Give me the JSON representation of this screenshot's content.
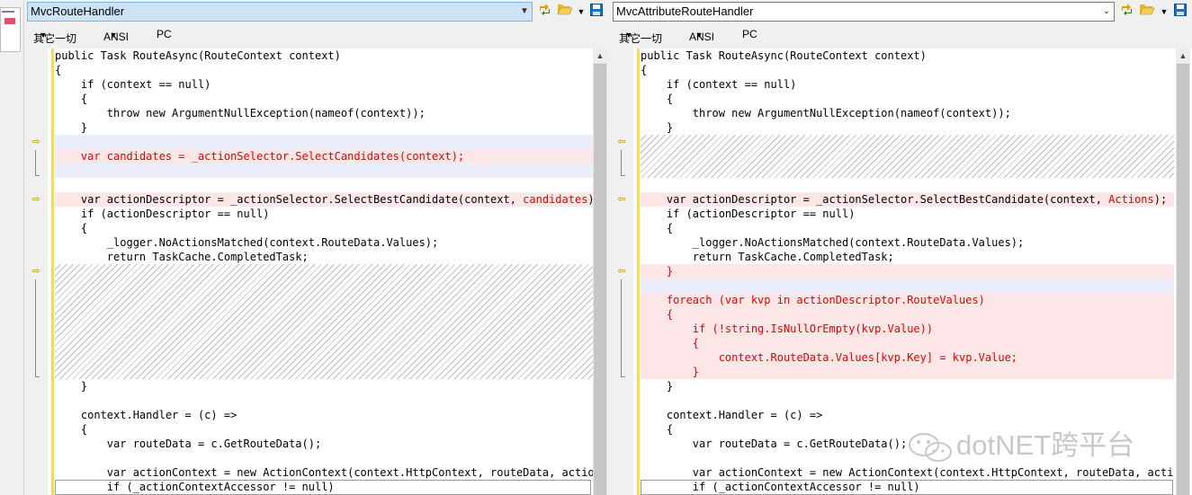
{
  "left": {
    "filename": "MvcRouteHandler",
    "encoding": {
      "charset": "其它一切",
      "format": "ANSI",
      "lineEnding": "PC"
    },
    "lines": [
      "public Task RouteAsync(RouteContext context)",
      "{",
      "    if (context == null)",
      "    {",
      "        throw new ArgumentNullException(nameof(context));",
      "    }",
      "",
      "    var candidates = _actionSelector.SelectCandidates(context);",
      "",
      "",
      "    var actionDescriptor = _actionSelector.SelectBestCandidate(context, ",
      "    if (actionDescriptor == null)",
      "    {",
      "        _logger.NoActionsMatched(context.RouteData.Values);",
      "        return TaskCache.CompletedTask;",
      "    }",
      "",
      "    context.Handler = (c) =>",
      "    {",
      "        var routeData = c.GetRouteData();",
      "",
      "        var actionContext = new ActionContext(context.HttpContext, routeData, actionD",
      "        if (_actionContextAccessor != null)"
    ],
    "diffToken": "candidates",
    "diffTokenSuffix": ");"
  },
  "right": {
    "filename": "MvcAttributeRouteHandler",
    "encoding": {
      "charset": "其它一切",
      "format": "ANSI",
      "lineEnding": "PC"
    },
    "lines": [
      "public Task RouteAsync(RouteContext context)",
      "{",
      "    if (context == null)",
      "    {",
      "        throw new ArgumentNullException(nameof(context));",
      "    }",
      "    var actionDescriptor = _actionSelector.SelectBestCandidate(context, ",
      "    if (actionDescriptor == null)",
      "    {",
      "        _logger.NoActionsMatched(context.RouteData.Values);",
      "        return TaskCache.CompletedTask;",
      "    }",
      "",
      "    foreach (var kvp in actionDescriptor.RouteValues)",
      "    {",
      "        if (!string.IsNullOrEmpty(kvp.Value))",
      "        {",
      "            context.RouteData.Values[kvp.Key] = kvp.Value;",
      "        }",
      "    }",
      "",
      "    context.Handler = (c) =>",
      "    {",
      "        var routeData = c.GetRouteData();",
      "",
      "        var actionContext = new ActionContext(context.HttpContext, routeData, actionD",
      "        if (_actionContextAccessor != null)"
    ],
    "diffToken": "Actions",
    "diffTokenSuffix": ");"
  },
  "watermark": "dotNET跨平台",
  "icons": {
    "dropdown": "chevron-down-icon",
    "recompare": "recompare-icon",
    "open": "folder-open-icon",
    "menu": "dropdown-arrow-icon",
    "save": "save-icon",
    "scrollUp": "scroll-up-icon",
    "diffArrowLeft": "arrow-right-icon",
    "diffArrowRight": "arrow-left-icon"
  },
  "colors": {
    "changed": "#e60000",
    "lineBgRed": "#fde6e8",
    "lineBgBlue": "#eceefc",
    "changeBar": "#f2dd4e"
  }
}
